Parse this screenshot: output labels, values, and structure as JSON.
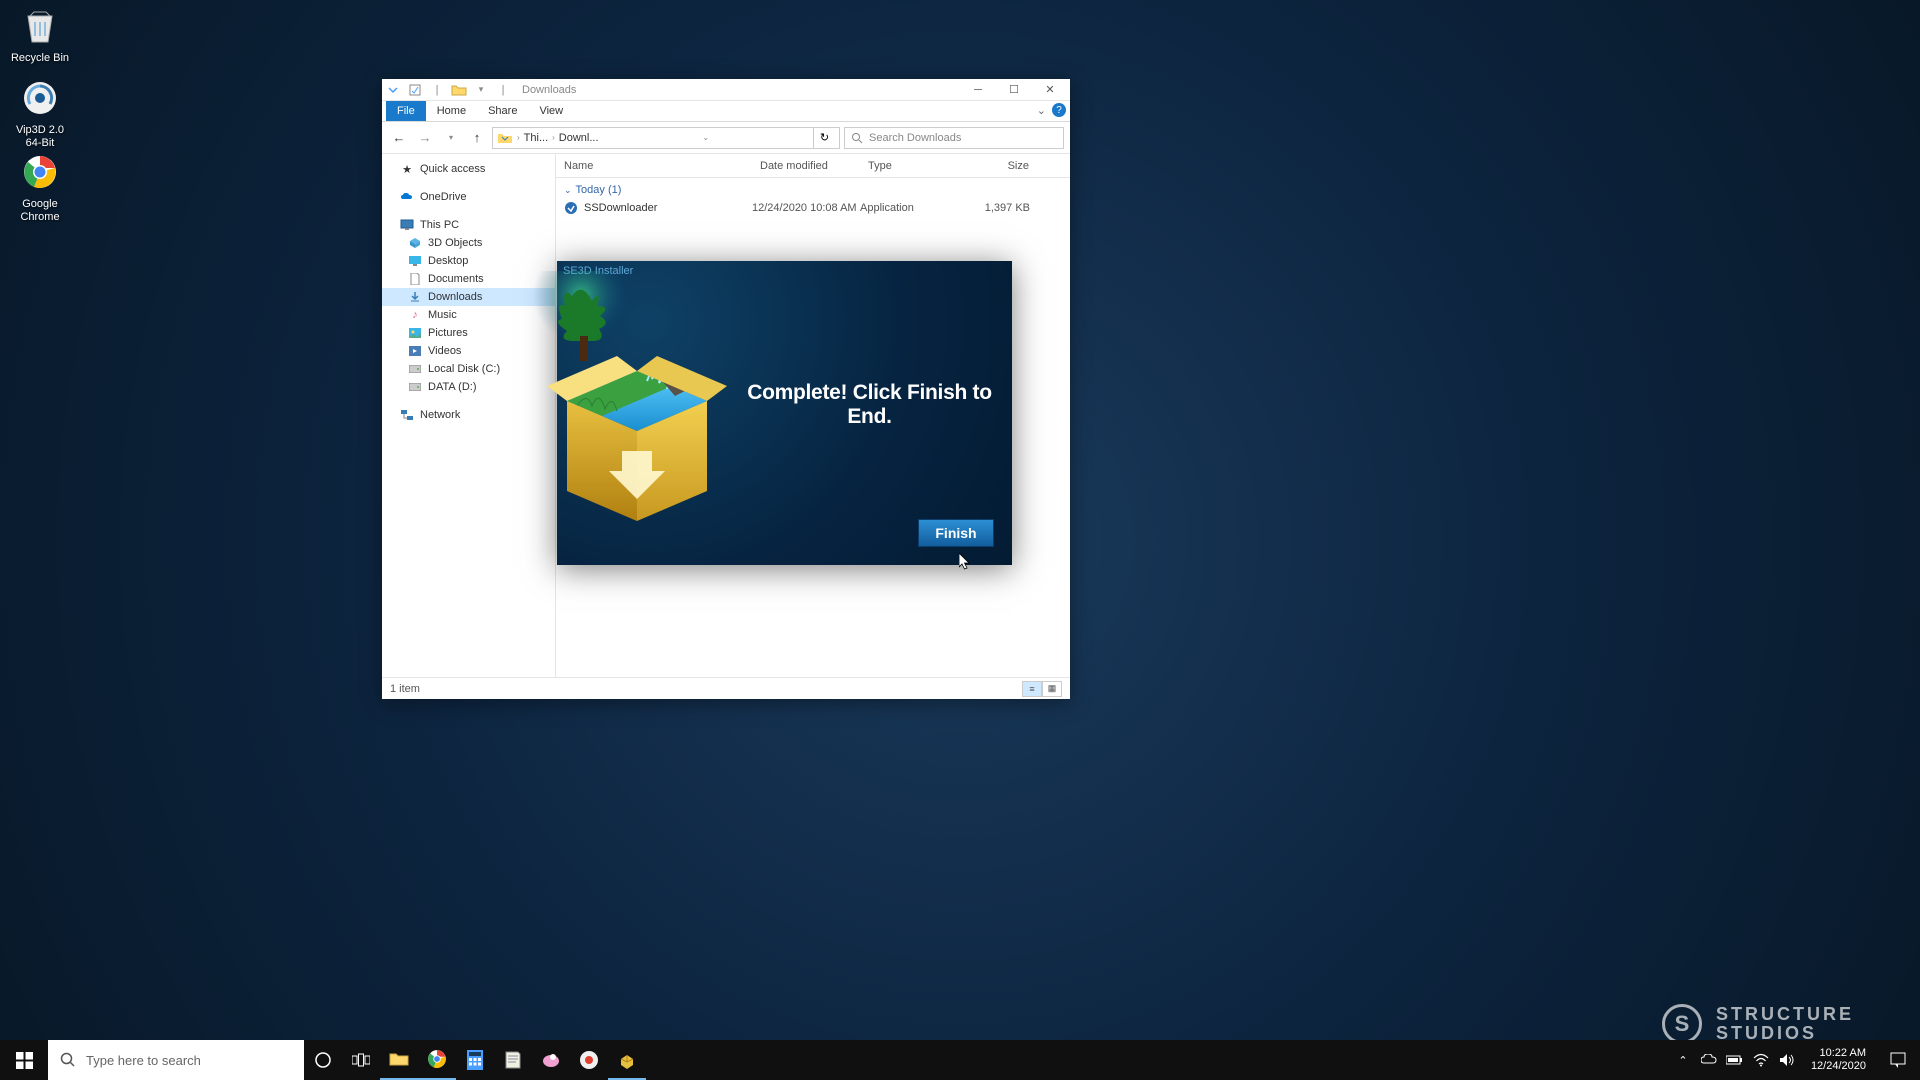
{
  "desktop": {
    "icons": [
      {
        "name": "recycle-bin",
        "label": "Recycle Bin"
      },
      {
        "name": "vip3d",
        "label": "Vip3D 2.0\n64-Bit"
      },
      {
        "name": "chrome",
        "label": "Google\nChrome"
      }
    ]
  },
  "explorer": {
    "title": "Downloads",
    "tabs": {
      "file": "File",
      "home": "Home",
      "share": "Share",
      "view": "View"
    },
    "breadcrumb": {
      "thispc": "Thi...",
      "downloads": "Downl..."
    },
    "search_placeholder": "Search Downloads",
    "tree": {
      "quick_access": "Quick access",
      "onedrive": "OneDrive",
      "thispc": "This PC",
      "children": {
        "objects3d": "3D Objects",
        "desktop": "Desktop",
        "documents": "Documents",
        "downloads": "Downloads",
        "music": "Music",
        "pictures": "Pictures",
        "videos": "Videos",
        "localc": "Local Disk (C:)",
        "datad": "DATA (D:)"
      },
      "network": "Network"
    },
    "columns": {
      "name": "Name",
      "date": "Date modified",
      "type": "Type",
      "size": "Size"
    },
    "group_today": "Today (1)",
    "files": [
      {
        "name": "SSDownloader",
        "date": "12/24/2020 10:08 AM",
        "type": "Application",
        "size": "1,397 KB"
      }
    ],
    "status": "1 item"
  },
  "installer": {
    "title": "SE3D Installer",
    "message": "Complete! Click Finish to End.",
    "finish_label": "Finish"
  },
  "watermark": {
    "line1": "STRUCTURE",
    "line2": "STUDIOS"
  },
  "taskbar": {
    "search_placeholder": "Type here to search",
    "clock_time": "10:22 AM",
    "clock_date": "12/24/2020"
  }
}
